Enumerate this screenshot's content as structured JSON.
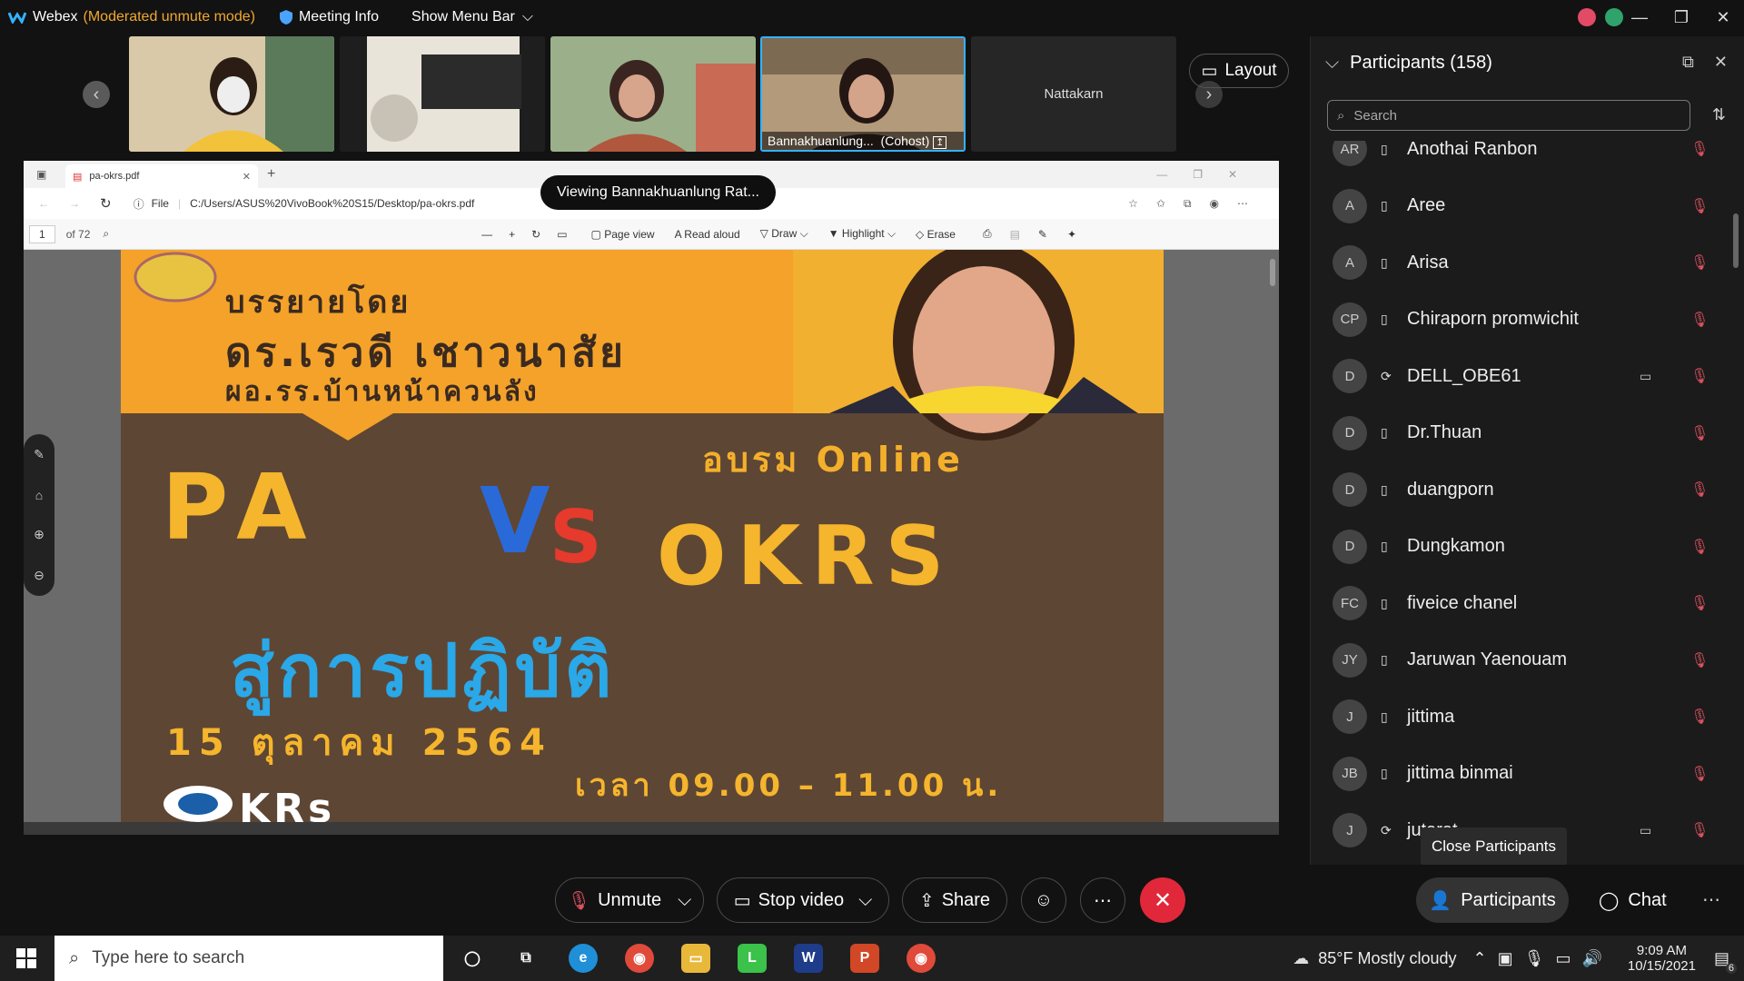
{
  "titlebar": {
    "app": "Webex",
    "mode": "(Moderated unmute mode)",
    "meeting_info": "Meeting Info",
    "menu_bar": "Show Menu Bar"
  },
  "thumbnails": [
    {
      "name": ""
    },
    {
      "name": ""
    },
    {
      "name": ""
    },
    {
      "name": "Bannakhuanlung...",
      "role": "(Cohost)"
    },
    {
      "name": "Nattakarn"
    }
  ],
  "layout_label": "Layout",
  "viewing_pill": "Viewing Bannakhuanlung Rat...",
  "browser": {
    "tab_title": "pa-okrs.pdf",
    "file_label": "File",
    "url": "C:/Users/ASUS%20VivoBook%20S15/Desktop/pa-okrs.pdf",
    "page_number": "1",
    "page_total": "of 72",
    "tools": [
      "Page view",
      "Read aloud",
      "Draw",
      "Highlight",
      "Erase"
    ]
  },
  "slide": {
    "line1": "บรรยายโดย",
    "line2": "ดร.เรวดี เชาวนาสัย",
    "line3": "ผอ.รร.บ้านหน้าควนลัง",
    "online": "อบรม Online",
    "pa": "PA",
    "vs_v": "V",
    "vs_s": "S",
    "okrs": "OKRS",
    "practice": "สู่การปฏิบัติ",
    "date": "15 ตุลาคม 2564",
    "time": "เวลา 09.00 – 11.00 น.",
    "logo_text": "KRs"
  },
  "participants": {
    "title": "Participants (158)",
    "search_placeholder": "Search",
    "list": [
      {
        "initials": "AR",
        "name": "Anothai Ranbon",
        "device": "phone",
        "video": false
      },
      {
        "initials": "A",
        "name": "Aree",
        "device": "phone",
        "video": false
      },
      {
        "initials": "A",
        "name": "Arisa",
        "device": "phone",
        "video": false
      },
      {
        "initials": "CP",
        "name": "Chiraporn promwichit",
        "device": "phone",
        "video": false
      },
      {
        "initials": "D",
        "name": "DELL_OBE61",
        "device": "sync",
        "video": true
      },
      {
        "initials": "D",
        "name": "Dr.Thuan",
        "device": "phone",
        "video": false
      },
      {
        "initials": "D",
        "name": "duangporn",
        "device": "phone",
        "video": false
      },
      {
        "initials": "D",
        "name": "Dungkamon",
        "device": "phone",
        "video": false
      },
      {
        "initials": "FC",
        "name": "fiveice chanel",
        "device": "phone",
        "video": false
      },
      {
        "initials": "JY",
        "name": "Jaruwan Yaenouam",
        "device": "phone",
        "video": false
      },
      {
        "initials": "J",
        "name": "jittima",
        "device": "phone",
        "video": false
      },
      {
        "initials": "JB",
        "name": "jittima binmai",
        "device": "phone",
        "video": false
      },
      {
        "initials": "J",
        "name": "jutarat",
        "device": "sync",
        "video": true
      }
    ],
    "tooltip": "Close Participants"
  },
  "controls": {
    "unmute": "Unmute",
    "stop_video": "Stop video",
    "share": "Share",
    "participants": "Participants",
    "chat": "Chat"
  },
  "taskbar": {
    "search_placeholder": "Type here to search",
    "weather": "85°F  Mostly cloudy",
    "time": "9:09 AM",
    "date": "10/15/2021",
    "notifications": "6"
  },
  "colors": {
    "accent_blue": "#33b3ff",
    "leave_red": "#e0283a",
    "mode_orange": "#f0a830",
    "muted_red": "#e05260"
  }
}
